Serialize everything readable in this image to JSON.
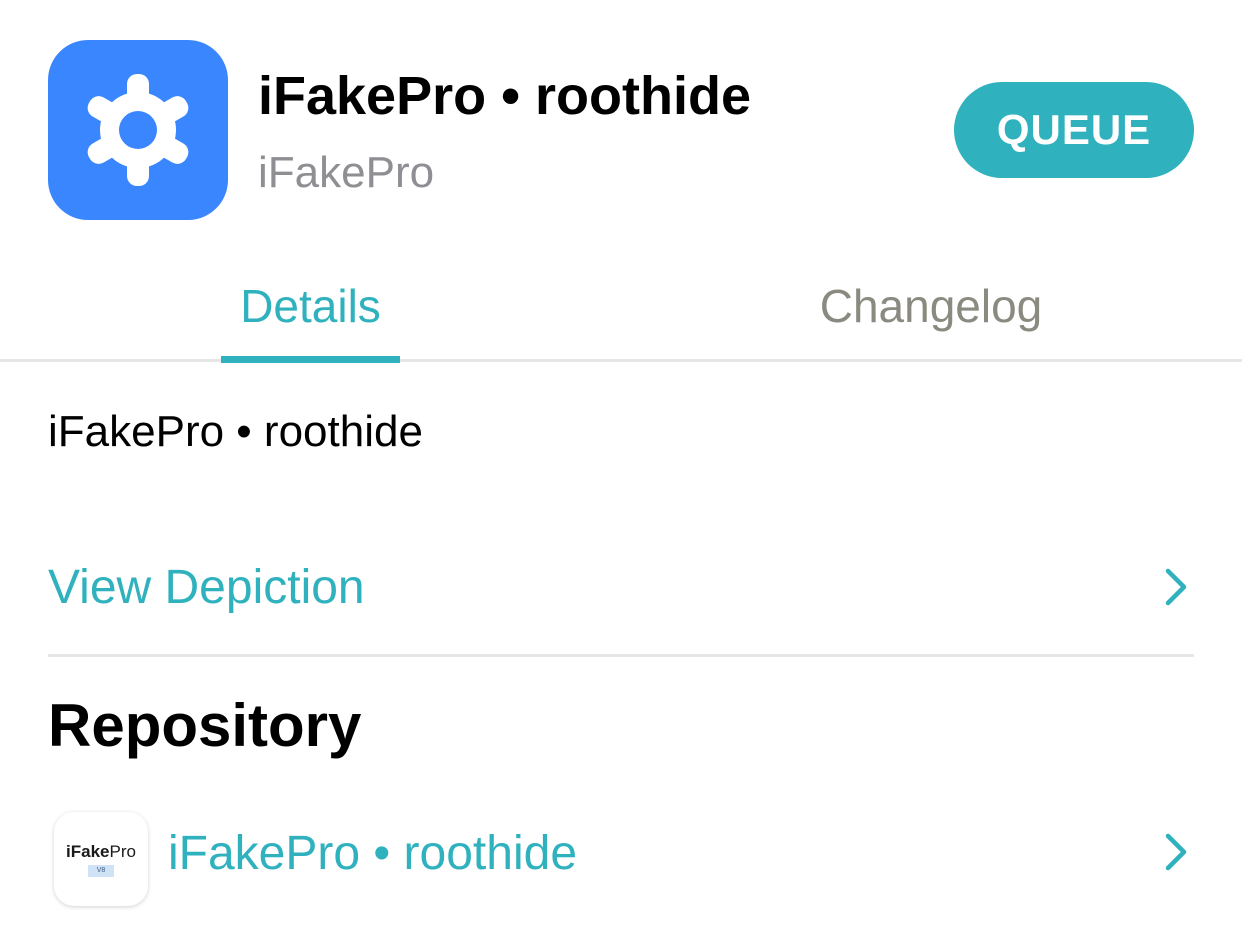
{
  "header": {
    "app_icon": "gear-icon",
    "title": "iFakePro • roothide",
    "author": "iFakePro",
    "queue_label": "QUEUE"
  },
  "tabs": [
    {
      "label": "Details",
      "selected": true
    },
    {
      "label": "Changelog",
      "selected": false
    }
  ],
  "details": {
    "description": "iFakePro • roothide",
    "view_depiction_label": "View Depiction",
    "repository_heading": "Repository",
    "repository": {
      "icon_name_bold": "iFake",
      "icon_name_light": "Pro",
      "icon_badge": "V8",
      "name": "iFakePro • roothide"
    }
  },
  "colors": {
    "accent": "#2fb1be",
    "app_icon_background": "#3a86ff",
    "secondary_text": "#8e8e93",
    "divider": "#e6e6e6"
  }
}
